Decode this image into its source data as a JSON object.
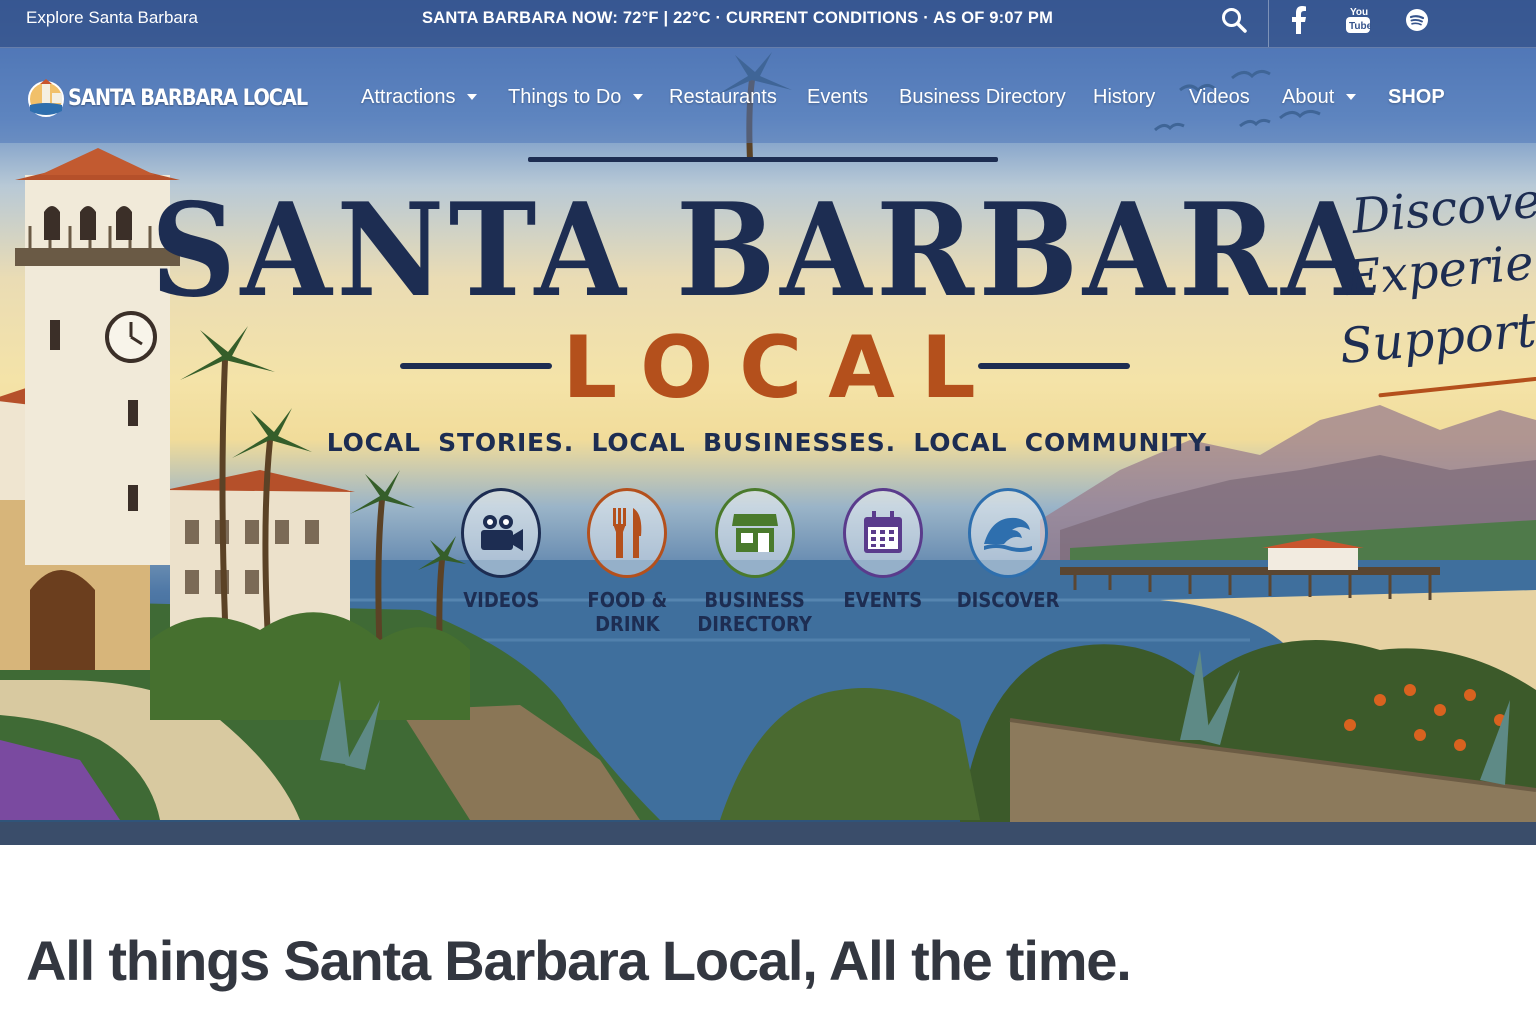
{
  "topbar": {
    "explore_label": "Explore Santa Barbara",
    "weather_text": "SANTA BARBARA NOW: 72°F | 22°C · CURRENT CONDITIONS · AS OF 9:07 PM",
    "icons": [
      "search-icon",
      "facebook-icon",
      "youtube-icon",
      "spotify-icon"
    ]
  },
  "nav": {
    "logo_text": "SANTA BARBARA LOCAL",
    "items": [
      {
        "label": "Attractions",
        "has_dropdown": true
      },
      {
        "label": "Things to Do",
        "has_dropdown": true
      },
      {
        "label": "Restaurants",
        "has_dropdown": false
      },
      {
        "label": "Events",
        "has_dropdown": false
      },
      {
        "label": "Business Directory",
        "has_dropdown": false
      },
      {
        "label": "History",
        "has_dropdown": false
      },
      {
        "label": "Videos",
        "has_dropdown": false
      },
      {
        "label": "About",
        "has_dropdown": true
      },
      {
        "label": "SHOP",
        "has_dropdown": false
      }
    ]
  },
  "hero": {
    "title": "SANTA BARBARA",
    "subtitle": "LOCAL",
    "tagline": "LOCAL STORIES.  LOCAL BUSINESSES.  LOCAL COMMUNITY.",
    "script_lines": [
      "Discover.",
      "Experience.",
      "Support Loc"
    ],
    "categories": [
      {
        "label": "VIDEOS",
        "icon": "video-camera-icon",
        "color": "#1d2d52"
      },
      {
        "label": "FOOD &\nDRINK",
        "icon": "fork-knife-icon",
        "color": "#b4501c"
      },
      {
        "label": "BUSINESS\nDIRECTORY",
        "icon": "storefront-icon",
        "color": "#4a7a2c"
      },
      {
        "label": "EVENTS",
        "icon": "calendar-icon",
        "color": "#5a3b8c"
      },
      {
        "label": "DISCOVER",
        "icon": "wave-icon",
        "color": "#2e6fae"
      }
    ]
  },
  "main": {
    "headline": "All things Santa Barbara Local, All the time."
  },
  "colors": {
    "navy": "#1d2d52",
    "terracotta": "#b4501c",
    "headline_text": "#333740",
    "topbar_bg": "#36548c"
  }
}
